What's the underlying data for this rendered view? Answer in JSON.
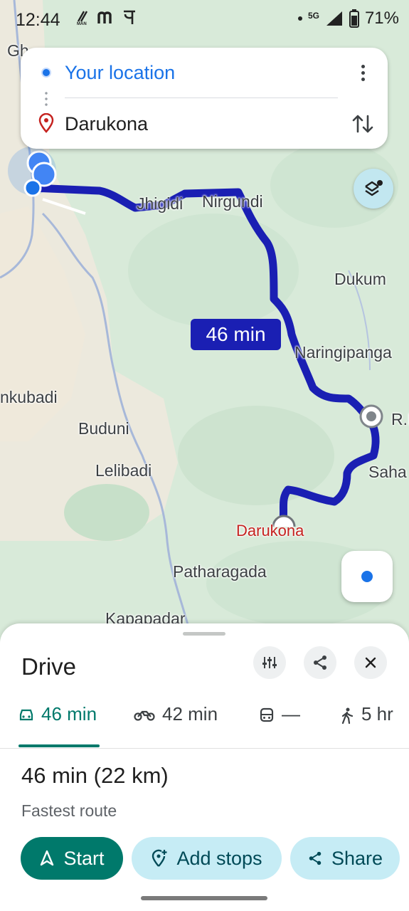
{
  "status_bar": {
    "time": "12:44",
    "left_icons": [
      "nfc-icon",
      "m-app-icon",
      "pe-app-icon"
    ],
    "network": "5G",
    "battery": "71%"
  },
  "route": {
    "from": "Your location",
    "to": "Darukona"
  },
  "map": {
    "places": [
      "Jhigidi",
      "Nirgundi",
      "Dukum",
      "Naringipanga",
      "nkubadi",
      "Buduni",
      "R.I",
      "Saha",
      "Lelibadi",
      "Darukona",
      "Patharagada",
      "Kapapadar",
      "Gh..."
    ],
    "route_time": "46 min",
    "route_color": "#1a1fb3"
  },
  "sheet": {
    "title": "Drive",
    "modes": [
      {
        "icon": "car-icon",
        "label": "46 min",
        "active": true
      },
      {
        "icon": "motorcycle-icon",
        "label": "42 min",
        "active": false
      },
      {
        "icon": "transit-icon",
        "label": "—",
        "active": false
      },
      {
        "icon": "walk-icon",
        "label": "5 hr",
        "active": false
      }
    ],
    "summary_time": "46 min",
    "summary_distance": "(22 km)",
    "subtitle": "Fastest route",
    "buttons": {
      "start": "Start",
      "add_stops": "Add stops",
      "share": "Share"
    }
  },
  "colors": {
    "accent": "#00796b",
    "link_blue": "#1a73e8",
    "destination_red": "#c5221f"
  }
}
